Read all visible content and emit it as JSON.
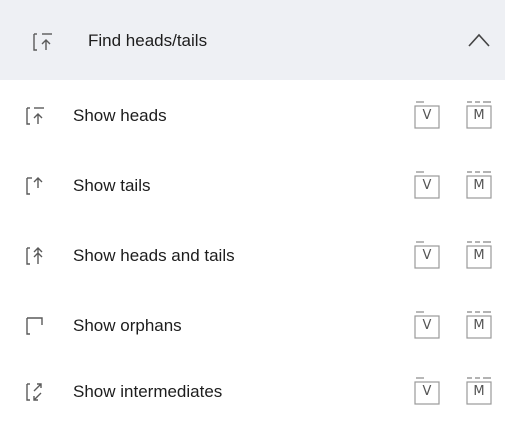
{
  "section": {
    "title": "Find heads/tails",
    "header_icon": "find-heads-tails-icon",
    "collapse_icon": "chevron-up-icon"
  },
  "items": [
    {
      "label": "Show heads",
      "icon": "show-heads-icon",
      "shortcut_keys": [
        "V",
        "M"
      ]
    },
    {
      "label": "Show tails",
      "icon": "show-tails-icon",
      "shortcut_keys": [
        "V",
        "M"
      ]
    },
    {
      "label": "Show heads and tails",
      "icon": "show-heads-tails-icon",
      "shortcut_keys": [
        "V",
        "M"
      ]
    },
    {
      "label": "Show orphans",
      "icon": "show-orphans-icon",
      "shortcut_keys": [
        "V",
        "M"
      ]
    },
    {
      "label": "Show intermediates",
      "icon": "show-intermediates-icon",
      "shortcut_keys": [
        "V",
        "M"
      ]
    }
  ],
  "colors": {
    "header_bg": "#eef0f4",
    "icon_stroke": "#5a5a5a",
    "key_stroke": "#9a9a9a"
  }
}
